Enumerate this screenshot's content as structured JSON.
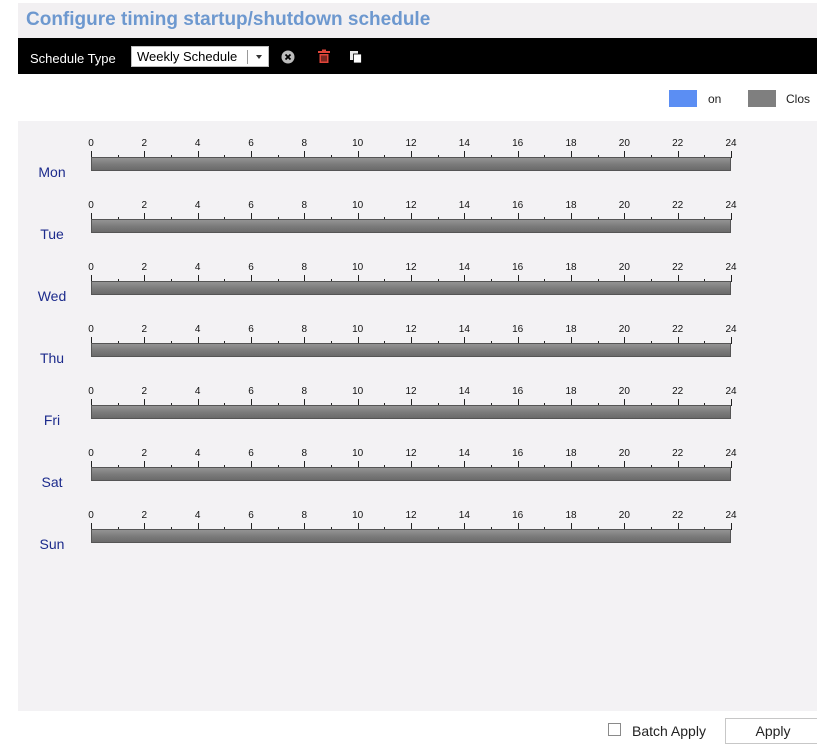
{
  "header": {
    "title": "Configure timing startup/shutdown schedule"
  },
  "toolbar": {
    "schedule_type_label": "Schedule Type",
    "schedule_type_value": "Weekly Schedule",
    "icons": [
      "clear-icon",
      "delete-icon",
      "copy-icon"
    ],
    "icon_colors": {
      "clear": "#bdbdbd",
      "delete": "#e0453a",
      "copy": "#ffffff"
    }
  },
  "legend": [
    {
      "label": "on",
      "color": "#5b8ef3"
    },
    {
      "label": "Clos",
      "color": "#7f7f7f"
    }
  ],
  "schedule": {
    "tick_labels": [
      "0",
      "2",
      "4",
      "6",
      "8",
      "10",
      "12",
      "14",
      "16",
      "18",
      "20",
      "22",
      "24"
    ],
    "days": [
      {
        "label": "Mon"
      },
      {
        "label": "Tue"
      },
      {
        "label": "Wed"
      },
      {
        "label": "Thu"
      },
      {
        "label": "Fri"
      },
      {
        "label": "Sat"
      },
      {
        "label": "Sun"
      }
    ],
    "bar_color": "#7f7f7f"
  },
  "footer": {
    "batch_apply_label": "Batch Apply",
    "batch_apply_checked": false,
    "apply_label": "Apply"
  }
}
